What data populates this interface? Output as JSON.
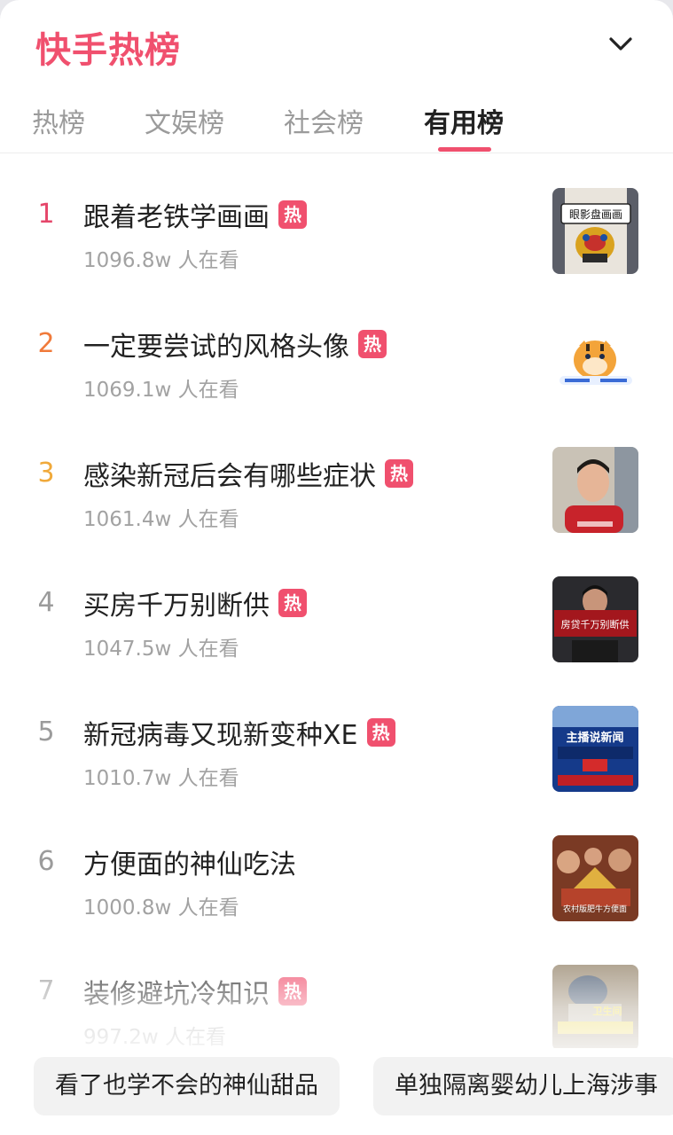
{
  "brand": "快手热榜",
  "tabs": [
    {
      "label": "热榜"
    },
    {
      "label": "文娱榜"
    },
    {
      "label": "社会榜"
    },
    {
      "label": "有用榜"
    }
  ],
  "hot_badge": "热",
  "accent_color": "#f0506e",
  "items": [
    {
      "rank": "1",
      "title": "跟着老铁学画画",
      "views": "1096.8w 人在看",
      "hot": true,
      "thumb_text": "眼影盘画画"
    },
    {
      "rank": "2",
      "title": "一定要尝试的风格头像",
      "views": "1069.1w 人在看",
      "hot": true,
      "thumb_text": ""
    },
    {
      "rank": "3",
      "title": "感染新冠后会有哪些症状",
      "views": "1061.4w 人在看",
      "hot": true,
      "thumb_text": ""
    },
    {
      "rank": "4",
      "title": "买房千万别断供",
      "views": "1047.5w 人在看",
      "hot": true,
      "thumb_text": "房贷千万别断供"
    },
    {
      "rank": "5",
      "title": "新冠病毒又现新变种XE",
      "views": "1010.7w 人在看",
      "hot": true,
      "thumb_text": "主播说新闻"
    },
    {
      "rank": "6",
      "title": "方便面的神仙吃法",
      "views": "1000.8w 人在看",
      "hot": false,
      "thumb_text": "农村版肥牛方便面"
    },
    {
      "rank": "7",
      "title": "装修避坑冷知识",
      "views": "997.2w 人在看",
      "hot": true,
      "thumb_text": "卫生间"
    }
  ],
  "rank_colors": [
    "#e5466a",
    "#f07a3a",
    "#f0a93a",
    "#9b9b9b",
    "#9b9b9b",
    "#9b9b9b",
    "#9b9b9b"
  ],
  "bottom_chips": [
    {
      "label": "看了也学不会的神仙甜品"
    },
    {
      "label": "单独隔离婴幼儿上海涉事"
    }
  ]
}
